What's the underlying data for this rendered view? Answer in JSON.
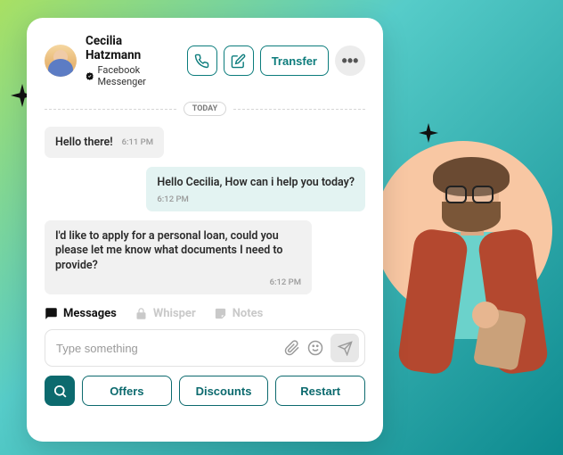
{
  "header": {
    "contact_name": "Cecilia Hatzmann",
    "source": "Facebook Messenger",
    "transfer_label": "Transfer",
    "more_label": "•••"
  },
  "date_pill": "TODAY",
  "messages": [
    {
      "side": "left",
      "text": "Hello there!",
      "time": "6:11 PM"
    },
    {
      "side": "right",
      "text": "Hello Cecilia, How can i help you today?",
      "time": "6:12 PM"
    },
    {
      "side": "left",
      "text": "I'd like to apply for a personal loan, could you please let me know what documents I need to provide?",
      "time": "6:12 PM"
    }
  ],
  "tabs": {
    "messages": "Messages",
    "whisper": "Whisper",
    "notes": "Notes"
  },
  "compose": {
    "placeholder": "Type something"
  },
  "footer": {
    "offers": "Offers",
    "discounts": "Discounts",
    "restart": "Restart"
  }
}
